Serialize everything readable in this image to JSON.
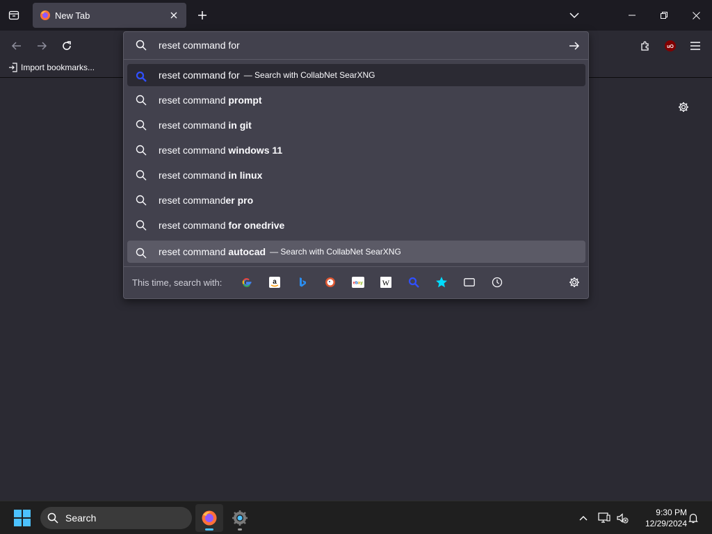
{
  "browser": {
    "tab": {
      "title": "New Tab"
    },
    "bookmarks": {
      "import_label": "Import bookmarks..."
    }
  },
  "urlbar": {
    "value": "reset command for",
    "results": [
      {
        "prefix": "reset command for",
        "bold": "",
        "action": "— Search with CollabNet SearXNG",
        "selected": true
      },
      {
        "prefix": "reset command ",
        "bold": "prompt",
        "action": ""
      },
      {
        "prefix": "reset command ",
        "bold": "in git",
        "action": ""
      },
      {
        "prefix": "reset command ",
        "bold": "windows 11",
        "action": ""
      },
      {
        "prefix": "reset command ",
        "bold": "in linux",
        "action": ""
      },
      {
        "prefix": "reset command",
        "bold": "er pro",
        "action": ""
      },
      {
        "prefix": "reset command ",
        "bold": "for onedrive",
        "action": ""
      },
      {
        "prefix": "reset command ",
        "bold": "autocad",
        "action": "— Search with CollabNet SearXNG",
        "hover": true
      }
    ],
    "oneoff": {
      "label": "This time, search with:",
      "engines": [
        "google-icon",
        "amazon-icon",
        "bing-icon",
        "duckduckgo-icon",
        "ebay-icon",
        "wikipedia-icon",
        "searxng-icon",
        "bookmarks-icon",
        "tabs-icon",
        "history-icon"
      ]
    }
  },
  "taskbar": {
    "search_label": "Search",
    "time": "9:30 PM",
    "date": "12/29/2024"
  },
  "colors": {
    "background": "#2b2a33",
    "tabstrip": "#1c1b22",
    "popup": "#42414d",
    "accent_blue": "#4cc2ff"
  }
}
